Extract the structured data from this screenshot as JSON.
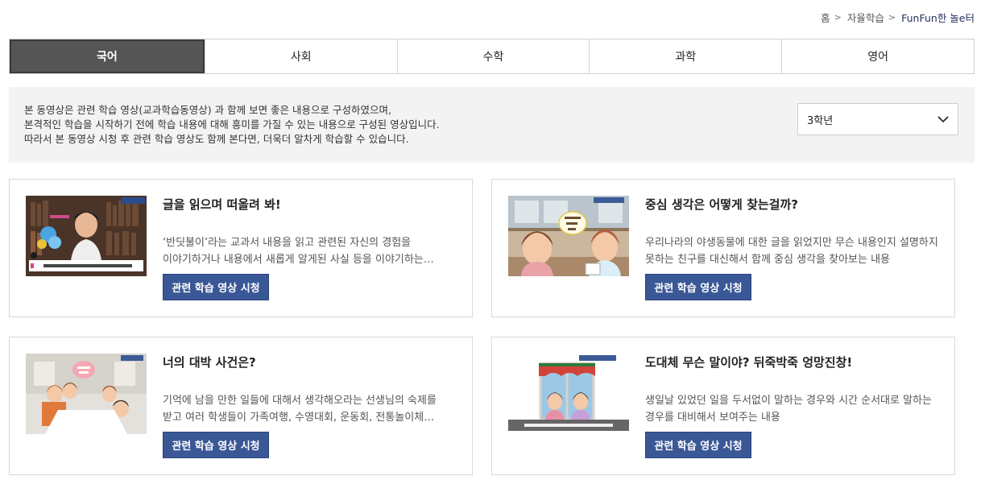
{
  "breadcrumb": {
    "items": [
      "홈",
      "자율학습"
    ],
    "current": "FunFun한 놀e터"
  },
  "tabs": [
    {
      "label": "국어",
      "active": true
    },
    {
      "label": "사회",
      "active": false
    },
    {
      "label": "수학",
      "active": false
    },
    {
      "label": "과학",
      "active": false
    },
    {
      "label": "영어",
      "active": false
    }
  ],
  "info": {
    "lines": [
      "본 동영상은 관련 학습 영상(교과학습동영상) 과 함께 보면 좋은 내용으로 구성하였으며,",
      "본격적인 학습을 시작하기 전에 학습 내용에 대해 흥미를 가질 수 있는 내용으로 구성된 영상입니다.",
      "따라서 본 동영상 시청 후 관련 학습 영상도 함께 본다면, 더욱더 알차게 학습할 수 있습니다."
    ],
    "grade_select": {
      "value": "3학년",
      "icon": "chevron-down-icon"
    }
  },
  "cards": [
    {
      "title": "글을 읽으며 떠올려 봐!",
      "desc": [
        "‘반딧불이’라는 교과서 내용을 읽고 관련된 자신의 경험을",
        "이야기하거나 내용에서 새롭게 알게된 사실 등을 이야기하는…"
      ],
      "button": "관련 학습 영상 시청"
    },
    {
      "title": "중심 생각은 어떻게 찾는걸까?",
      "desc": [
        "우리나라의 야생동물에 대한 글을 읽었지만 무슨 내용인지 설명하지",
        "못하는 친구를 대신해서 함께 중심 생각을 찾아보는 내용"
      ],
      "button": "관련 학습 영상 시청"
    },
    {
      "title": "너의 대박 사건은?",
      "desc": [
        "기억에 남을 만한 일들에 대해서 생각해오라는 선생님의 숙제를",
        "받고 여러 학생들이 가족여행, 수영대회, 운동회, 전통놀이체…"
      ],
      "button": "관련 학습 영상 시청"
    },
    {
      "title": "도대체 무슨 말이야? 뒤죽박죽 엉망진창!",
      "desc": [
        "생일날 있었던 일을 두서없이 말하는 경우와 시간 순서대로 말하는",
        "경우를 대비해서 보여주는 내용"
      ],
      "button": "관련 학습 영상 시청"
    }
  ],
  "colors": {
    "active_tab": "#555555",
    "button": "#3a5796",
    "info_bg": "#f3f3f3"
  }
}
